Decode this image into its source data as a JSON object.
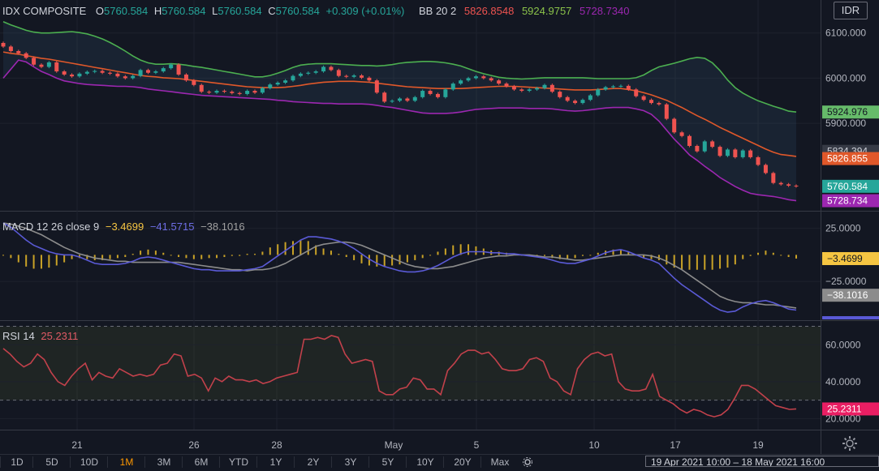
{
  "currency": "IDR",
  "legend_main": {
    "symbol": "IDX COMPOSITE",
    "o_label": "O",
    "o_val": "5760.584",
    "h_label": "H",
    "h_val": "5760.584",
    "l_label": "L",
    "l_val": "5760.584",
    "c_label": "C",
    "c_val": "5760.584",
    "change": "+0.309 (+0.01%)",
    "bb_label": "BB 20 2",
    "bb_mid": "5826.8548",
    "bb_up": "5924.9757",
    "bb_low": "5728.7340"
  },
  "legend_macd": {
    "label": "MACD 12 26 close 9",
    "hist": "−3.4699",
    "macd": "−41.5715",
    "signal": "−38.1016"
  },
  "legend_rsi": {
    "label": "RSI 14",
    "value": "25.2311"
  },
  "colors": {
    "up": "#26a69a",
    "down": "#ef5350",
    "bb_mid": "#e0582a",
    "bb_up": "#4caf50",
    "bb_low": "#9c27b0",
    "macd": "#5a5ad6",
    "signal": "#8c8c8c",
    "hist": "#c9a227",
    "rsi": "#c2414b"
  },
  "bottom": {
    "timeframes": [
      "1D",
      "5D",
      "10D",
      "1M",
      "3M",
      "6M",
      "YTD",
      "1Y",
      "2Y",
      "3Y",
      "5Y",
      "10Y",
      "20Y",
      "Max"
    ],
    "active": "1M",
    "range": "19 Apr 2021 10:00 – 18 May 2021 16:00"
  },
  "chart_data": [
    {
      "type": "candlestick",
      "title": "IDX COMPOSITE",
      "x_ticks": [
        "21",
        "26",
        "28",
        "May",
        "5",
        "10",
        "17",
        "19"
      ],
      "y_ticks": [
        "6100.000",
        "6000.000",
        "5900.000"
      ],
      "ylim": [
        5710,
        6130
      ],
      "price_labels": {
        "bb_up": "5924.976",
        "prev": "5834.394",
        "bb_mid": "5826.855",
        "last": "5760.584",
        "bb_low": "5728.734"
      },
      "close": [
        6070,
        6060,
        6055,
        6045,
        6030,
        6025,
        6035,
        6015,
        6008,
        6004,
        6010,
        6014,
        6016,
        6012,
        6010,
        6004,
        6000,
        6005,
        6018,
        6012,
        6015,
        6022,
        6030,
        6008,
        5995,
        5985,
        5970,
        5968,
        5972,
        5970,
        5967,
        5965,
        5972,
        5968,
        5978,
        5986,
        5990,
        5995,
        6005,
        6010,
        6012,
        6015,
        6025,
        6018,
        6005,
        6003,
        6006,
        6001,
        5995,
        5968,
        5948,
        5950,
        5955,
        5950,
        5958,
        5972,
        5965,
        5958,
        5975,
        5988,
        5995,
        6000,
        6004,
        6000,
        5995,
        5988,
        5982,
        5975,
        5972,
        5975,
        5978,
        5985,
        5970,
        5958,
        5950,
        5945,
        5952,
        5962,
        5975,
        5980,
        5982,
        5983,
        5975,
        5960,
        5952,
        5945,
        5942,
        5910,
        5880,
        5872,
        5850,
        5838,
        5860,
        5848,
        5828,
        5842,
        5825,
        5840,
        5825,
        5808,
        5790,
        5768,
        5765,
        5762,
        5760.584
      ],
      "bb_mid": [
        6058,
        6055,
        6053,
        6050,
        6047,
        6044,
        6042,
        6039,
        6036,
        6033,
        6030,
        6027,
        6024,
        6021,
        6018,
        6015,
        6012,
        6009,
        6006,
        6004,
        6003,
        6001,
        6000,
        5999,
        5997,
        5995,
        5993,
        5991,
        5989,
        5987,
        5985,
        5983,
        5981,
        5980,
        5979,
        5979,
        5979,
        5980,
        5982,
        5984,
        5987,
        5989,
        5991,
        5992,
        5993,
        5993,
        5993,
        5992,
        5991,
        5989,
        5987,
        5985,
        5983,
        5981,
        5980,
        5979,
        5978,
        5977,
        5977,
        5977,
        5977,
        5978,
        5979,
        5980,
        5981,
        5982,
        5982,
        5982,
        5981,
        5980,
        5979,
        5978,
        5977,
        5976,
        5975,
        5974,
        5974,
        5974,
        5975,
        5976,
        5977,
        5977,
        5975,
        5972,
        5968,
        5963,
        5957,
        5951,
        5943,
        5935,
        5926,
        5917,
        5909,
        5900,
        5891,
        5883,
        5875,
        5867,
        5859,
        5851,
        5843,
        5836,
        5831,
        5829,
        5826.855
      ],
      "bb_up": [
        6125,
        6118,
        6112,
        6106,
        6102,
        6100,
        6100,
        6101,
        6102,
        6103,
        6101,
        6098,
        6093,
        6087,
        6079,
        6070,
        6060,
        6049,
        6040,
        6034,
        6031,
        6031,
        6032,
        6031,
        6029,
        6026,
        6024,
        6021,
        6018,
        6015,
        6012,
        6009,
        6006,
        6003,
        6003,
        6006,
        6011,
        6017,
        6024,
        6029,
        6031,
        6032,
        6032,
        6032,
        6031,
        6030,
        6029,
        6028,
        6028,
        6027,
        6028,
        6030,
        6033,
        6035,
        6036,
        6037,
        6037,
        6036,
        6034,
        6031,
        6027,
        6021,
        6015,
        6010,
        6006,
        6002,
        6000,
        5999,
        5998,
        5999,
        6000,
        6001,
        6001,
        6001,
        6001,
        6001,
        6001,
        6000,
        5999,
        5999,
        5999,
        5999,
        5999,
        6001,
        6007,
        6017,
        6025,
        6029,
        6033,
        6038,
        6043,
        6046,
        6044,
        6034,
        6017,
        5996,
        5979,
        5967,
        5958,
        5950,
        5944,
        5938,
        5933,
        5927,
        5924.976
      ],
      "bb_low": [
        6000,
        6020,
        6040,
        6036,
        6025,
        6015,
        6008,
        6000,
        5994,
        5991,
        5988,
        5986,
        5985,
        5984,
        5983,
        5982,
        5982,
        5981,
        5979,
        5976,
        5974,
        5972,
        5970,
        5968,
        5966,
        5964,
        5962,
        5961,
        5960,
        5959,
        5958,
        5957,
        5956,
        5955,
        5954,
        5953,
        5951,
        5950,
        5948,
        5947,
        5946,
        5945,
        5944,
        5944,
        5943,
        5943,
        5943,
        5943,
        5942,
        5940,
        5937,
        5935,
        5932,
        5929,
        5926,
        5923,
        5922,
        5922,
        5922,
        5923,
        5925,
        5928,
        5931,
        5932,
        5933,
        5934,
        5934,
        5934,
        5934,
        5933,
        5933,
        5933,
        5932,
        5930,
        5928,
        5927,
        5928,
        5930,
        5932,
        5934,
        5935,
        5935,
        5935,
        5932,
        5928,
        5920,
        5905,
        5885,
        5865,
        5848,
        5830,
        5818,
        5805,
        5793,
        5780,
        5770,
        5760,
        5752,
        5745,
        5742,
        5740,
        5738,
        5735,
        5731,
        5728.734
      ],
      "series": [
        {
          "name": "BB 20 2 basis",
          "values_key": "bb_mid"
        },
        {
          "name": "BB 20 2 upper",
          "values_key": "bb_up"
        },
        {
          "name": "BB 20 2 lower",
          "values_key": "bb_low"
        }
      ]
    },
    {
      "type": "line",
      "title": "MACD 12 26 close 9",
      "y_ticks": [
        "25.0000",
        "−25.0000"
      ],
      "ylim": [
        -60,
        40
      ],
      "price_labels": {
        "hist": "−3.4699",
        "signal": "−38.1016",
        "macd": "−41.5715"
      },
      "macd": [
        30,
        26,
        20,
        14,
        9,
        6,
        3,
        1,
        0,
        0,
        -2,
        -5,
        -8,
        -9,
        -9,
        -9,
        -8,
        -6,
        -3,
        -2,
        -3,
        -5,
        -7,
        -9,
        -11,
        -13,
        -14,
        -14,
        -15,
        -15,
        -15,
        -15,
        -14,
        -13,
        -11,
        -6,
        -1,
        4,
        9,
        14,
        17,
        17,
        16,
        15,
        13,
        10,
        6,
        1,
        -4,
        -8,
        -11,
        -13,
        -15,
        -16,
        -16,
        -15,
        -13,
        -10,
        -6,
        -2,
        1,
        3,
        3,
        3,
        2,
        2,
        1,
        1,
        0,
        -1,
        -2,
        -3,
        -5,
        -7,
        -8,
        -8,
        -6,
        -4,
        -1,
        2,
        4,
        5,
        3,
        0,
        -3,
        -5,
        -8,
        -15,
        -22,
        -28,
        -33,
        -38,
        -43,
        -48,
        -52,
        -54,
        -53,
        -49,
        -46,
        -44,
        -43,
        -45,
        -48,
        -51,
        -52
      ],
      "signal": [
        30,
        29,
        27,
        25,
        22,
        19,
        15,
        11,
        7,
        4,
        1,
        -1,
        -3,
        -4,
        -5,
        -6,
        -6,
        -7,
        -7,
        -7,
        -7,
        -7,
        -7,
        -7,
        -8,
        -9,
        -10,
        -11,
        -12,
        -13,
        -14,
        -14,
        -15,
        -14,
        -14,
        -13,
        -11,
        -8,
        -4,
        0,
        4,
        8,
        10,
        11,
        12,
        12,
        11,
        9,
        6,
        3,
        0,
        -3,
        -6,
        -9,
        -11,
        -12,
        -13,
        -13,
        -12,
        -11,
        -9,
        -7,
        -5,
        -3,
        -2,
        -1,
        -1,
        0,
        0,
        0,
        -1,
        -2,
        -2,
        -3,
        -4,
        -5,
        -5,
        -4,
        -3,
        -2,
        -1,
        0,
        0,
        0,
        0,
        -1,
        -3,
        -6,
        -10,
        -14,
        -19,
        -24,
        -29,
        -34,
        -39,
        -42,
        -44,
        -45,
        -45,
        -46,
        -47,
        -47,
        -48,
        -49,
        -50
      ],
      "hist": [
        0,
        -3,
        -7,
        -11,
        -13,
        -13,
        -12,
        -10,
        -7,
        -4,
        -3,
        -4,
        -5,
        -5,
        -4,
        -3,
        -2,
        1,
        4,
        5,
        4,
        2,
        0,
        -2,
        -3,
        -4,
        -4,
        -3,
        -3,
        -2,
        -1,
        -1,
        1,
        1,
        3,
        7,
        10,
        12,
        13,
        14,
        13,
        9,
        6,
        4,
        1,
        -2,
        -5,
        -8,
        -10,
        -11,
        -11,
        -10,
        -9,
        -7,
        -5,
        -3,
        0,
        3,
        6,
        9,
        10,
        10,
        8,
        6,
        4,
        3,
        2,
        1,
        0,
        -1,
        -1,
        -1,
        -3,
        -4,
        -4,
        -3,
        -1,
        0,
        2,
        4,
        5,
        5,
        3,
        0,
        -3,
        -4,
        -5,
        -9,
        -12,
        -14,
        -14,
        -14,
        -14,
        -14,
        -13,
        -12,
        -9,
        -4,
        -1,
        2,
        4,
        2,
        0,
        -2,
        -3.4699
      ],
      "series": [
        {
          "name": "MACD",
          "values_key": "macd"
        },
        {
          "name": "signal",
          "values_key": "signal"
        },
        {
          "name": "histogram",
          "values_key": "hist"
        }
      ]
    },
    {
      "type": "line",
      "title": "RSI 14",
      "y_ticks": [
        "60.0000",
        "40.0000",
        "20.0000"
      ],
      "ylim": [
        14,
        72
      ],
      "bands": [
        70,
        30
      ],
      "price_labels": {
        "rsi": "25.2311"
      },
      "values": [
        58,
        55,
        51,
        48,
        50,
        55,
        52,
        45,
        40,
        38,
        43,
        47,
        50,
        41,
        45,
        43,
        42,
        47,
        45,
        43,
        44,
        43,
        44,
        49,
        50,
        55,
        54,
        43,
        44,
        42,
        35,
        42,
        40,
        43,
        41,
        41,
        40,
        41,
        39,
        40,
        42,
        43,
        44,
        45,
        63,
        63,
        64,
        63,
        65,
        64,
        55,
        50,
        51,
        52,
        51,
        35,
        33,
        33,
        36,
        37,
        42,
        41,
        36,
        36,
        33,
        46,
        50,
        55,
        57,
        57,
        55,
        56,
        52,
        47,
        46,
        46,
        47,
        52,
        53,
        51,
        42,
        40,
        35,
        33,
        47,
        52,
        55,
        56,
        54,
        55,
        40,
        36,
        35,
        35,
        36,
        44,
        32,
        30,
        28,
        25,
        23,
        25,
        24,
        22,
        21,
        22,
        25,
        31,
        38,
        38,
        36,
        33,
        30,
        27,
        26,
        25,
        25.2311
      ]
    }
  ]
}
